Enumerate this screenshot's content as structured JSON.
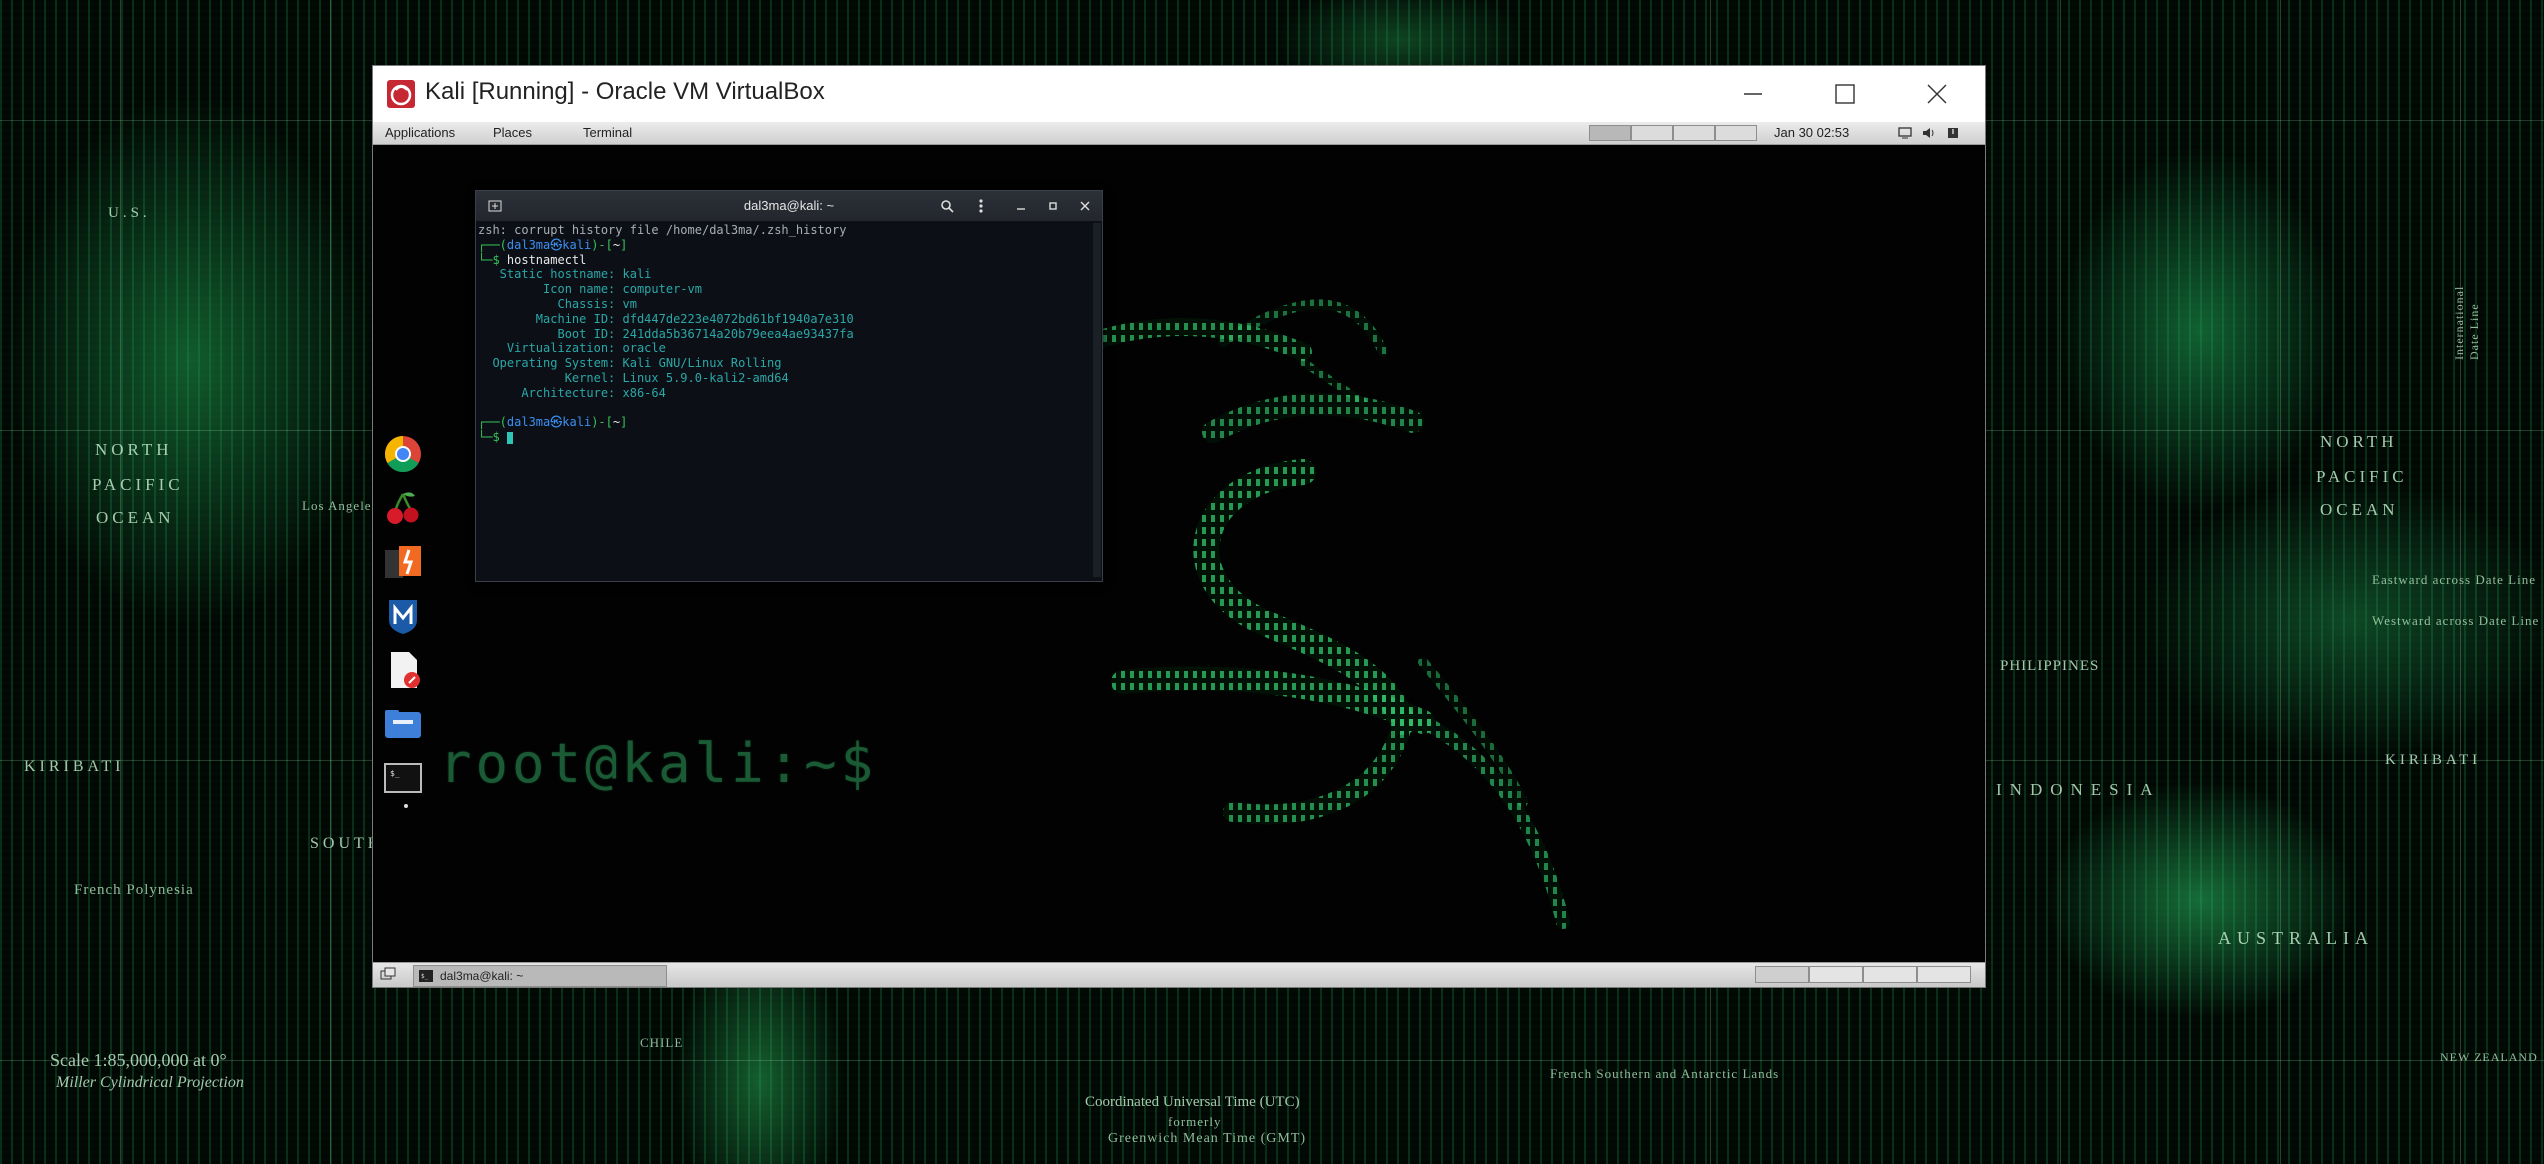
{
  "host": {
    "map_labels": {
      "north_pacific_left": [
        "NORTH",
        "PACIFIC",
        "OCEAN"
      ],
      "north_pacific_right": [
        "NORTH",
        "PACIFIC",
        "OCEAN"
      ],
      "australia": "AUSTRALIA",
      "philippines": "PHILIPPINES",
      "indonesia": "INDONESIA",
      "kiribati_left": "KIRIBATI",
      "kiribati_right": "KIRIBATI",
      "french_polynesia": "French Polynesia",
      "south": "SOUTH",
      "us": "U.S.",
      "scale": "Scale 1:85,000,000 at 0°",
      "projection": "Miller Cylindrical Projection",
      "utc": "Coordinated Universal Time (UTC)",
      "utc_formerly": "formerly",
      "gmt": "Greenwich Mean Time (GMT)",
      "french_southern": "French Southern and Antarctic Lands",
      "new_zealand": "NEW ZEALAND",
      "chile": "CHILE",
      "idl": "International Date Line",
      "eastward": "Eastward across Date Line",
      "westward": "Westward across Date Line",
      "los_angeles": "Los Angeles"
    }
  },
  "vbox": {
    "title": "Kali [Running] - Oracle VM VirtualBox",
    "controls": [
      "minimize-icon",
      "maximize-icon",
      "close-icon"
    ]
  },
  "guest": {
    "topbar": {
      "menus": [
        "Applications",
        "Places",
        "Terminal"
      ],
      "clock": "Jan 30  02:53"
    },
    "desktop_prompt": "root@kali:~$",
    "dock": [
      "chrome-icon",
      "cherrytree-icon",
      "burpsuite-icon",
      "metasploit-icon",
      "document-viewer-icon",
      "file-manager-icon",
      "terminal-icon"
    ],
    "terminal": {
      "title": "dal3ma@kali: ~",
      "lines": {
        "l1": "zsh: corrupt history file /home/dal3ma/.zsh_history",
        "user": "dal3ma",
        "host": "kali",
        "dir": "~",
        "cmd": "hostnamectl",
        "kv": [
          {
            "k": "   Static hostname:",
            "v": " kali"
          },
          {
            "k": "         Icon name:",
            "v": " computer-vm"
          },
          {
            "k": "           Chassis:",
            "v": " vm"
          },
          {
            "k": "        Machine ID:",
            "v": " dfd447de223e4072bd61bf1940a7e310"
          },
          {
            "k": "           Boot ID:",
            "v": " 241dda5b36714a20b79eea4ae93437fa"
          },
          {
            "k": "    Virtualization:",
            "v": " oracle"
          },
          {
            "k": "  Operating System:",
            "v": " Kali GNU/Linux Rolling"
          },
          {
            "k": "            Kernel:",
            "v": " Linux 5.9.0-kali2-amd64"
          },
          {
            "k": "      Architecture:",
            "v": " x86-64"
          }
        ]
      }
    },
    "taskbar": {
      "task_label": "dal3ma@kali: ~"
    }
  }
}
